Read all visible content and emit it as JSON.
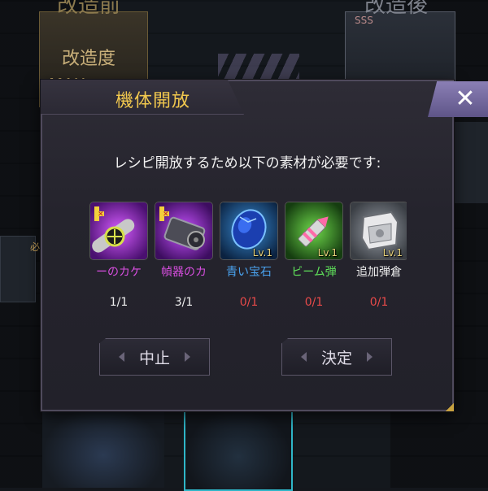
{
  "background": {
    "header_left": "改造前",
    "header_right": "改造後",
    "kaizo_label": "改造度",
    "max_label": "MAX",
    "rank": "SSS",
    "side_label": "必"
  },
  "dialog": {
    "title": "機体開放",
    "message": "レシピ開放するため以下の素材が必要です:",
    "materials": [
      {
        "name": "ーのカケ",
        "count": "1/1",
        "level": "",
        "name_color": "#d84ee0",
        "count_color": "#f0f0f0",
        "icon": "missile-fragment-icon"
      },
      {
        "name": "幀器のカ",
        "count": "3/1",
        "level": "",
        "name_color": "#d84ee0",
        "count_color": "#f0f0f0",
        "icon": "gatling-fragment-icon"
      },
      {
        "name": "青い宝石",
        "count": "0/1",
        "level": "Lv.1",
        "name_color": "#4aa3f0",
        "count_color": "#e84a4a",
        "icon": "blue-gem-icon"
      },
      {
        "name": "ビーム弾",
        "count": "0/1",
        "level": "Lv.1",
        "name_color": "#5fe05a",
        "count_color": "#e84a4a",
        "icon": "beam-bullet-icon"
      },
      {
        "name": "追加弾倉",
        "count": "0/1",
        "level": "Lv.1",
        "name_color": "#f0f0f0",
        "count_color": "#e84a4a",
        "icon": "extra-magazine-icon"
      }
    ],
    "cancel_label": "中止",
    "confirm_label": "決定",
    "close_symbol": "✕"
  },
  "colors": {
    "title": "#f1c84e",
    "close_button": "#7a6fa6",
    "missing_count": "#e84a4a"
  }
}
